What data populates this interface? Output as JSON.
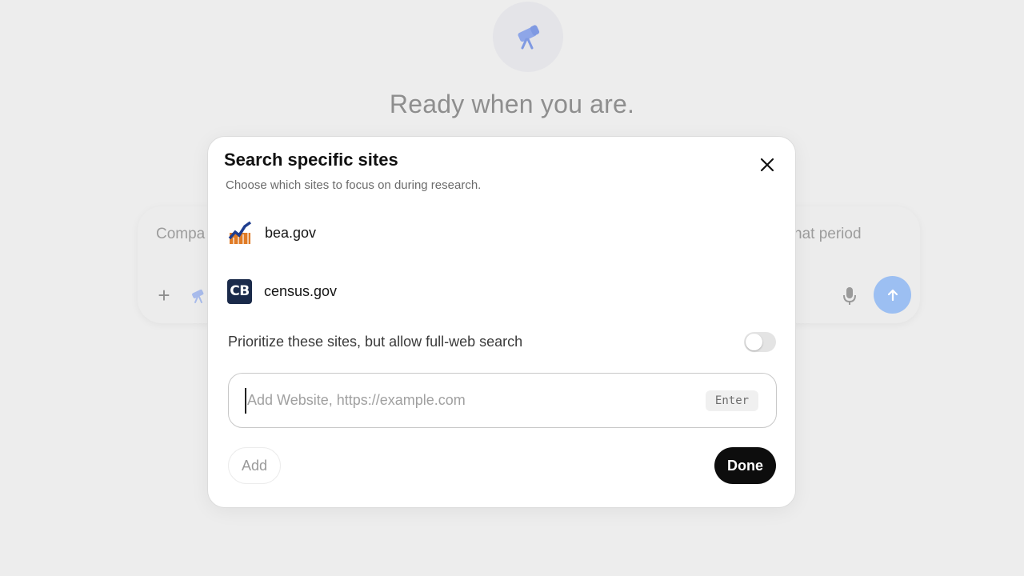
{
  "background": {
    "hero_title": "Ready when you are.",
    "composer_text_left": "Compa",
    "composer_text_right": "hat period",
    "plus_label": "+",
    "send_color": "#9cbff2"
  },
  "modal": {
    "title": "Search specific sites",
    "subtitle": "Choose which sites to focus on during research.",
    "sites": [
      {
        "label": "bea.gov",
        "icon": "bea-logo-icon"
      },
      {
        "label": "census.gov",
        "icon": "census-logo-icon",
        "logo_text": "CB"
      }
    ],
    "prioritize_label": "Prioritize these sites, but allow full-web search",
    "prioritize_enabled": false,
    "website_input": {
      "placeholder": "Add Website, https://example.com",
      "value": "",
      "enter_hint": "Enter"
    },
    "add_label": "Add",
    "done_label": "Done"
  },
  "colors": {
    "done_bg": "#0d0d0d",
    "backdrop": "#ededed"
  }
}
